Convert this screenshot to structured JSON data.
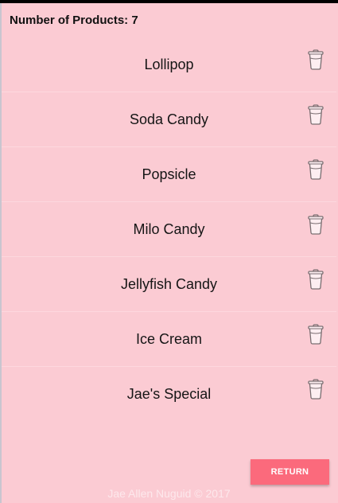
{
  "header": {
    "count_label": "Number of Products:",
    "count_value": "7"
  },
  "products": [
    {
      "name": "Lollipop",
      "icon": "trash-icon"
    },
    {
      "name": "Soda Candy",
      "icon": "trash-icon"
    },
    {
      "name": "Popsicle",
      "icon": "trash-icon"
    },
    {
      "name": "Milo Candy",
      "icon": "trash-icon"
    },
    {
      "name": "Jellyfish Candy",
      "icon": "trash-icon"
    },
    {
      "name": "Ice Cream",
      "icon": "trash-icon"
    },
    {
      "name": "Jae's Special",
      "icon": "trash-icon"
    }
  ],
  "actions": {
    "return_label": "RETURN"
  },
  "footer": {
    "credit": "Jae Allen Nuguid © 2017"
  },
  "colors": {
    "background": "#fbcbd3",
    "accent": "#fb6a7c"
  }
}
